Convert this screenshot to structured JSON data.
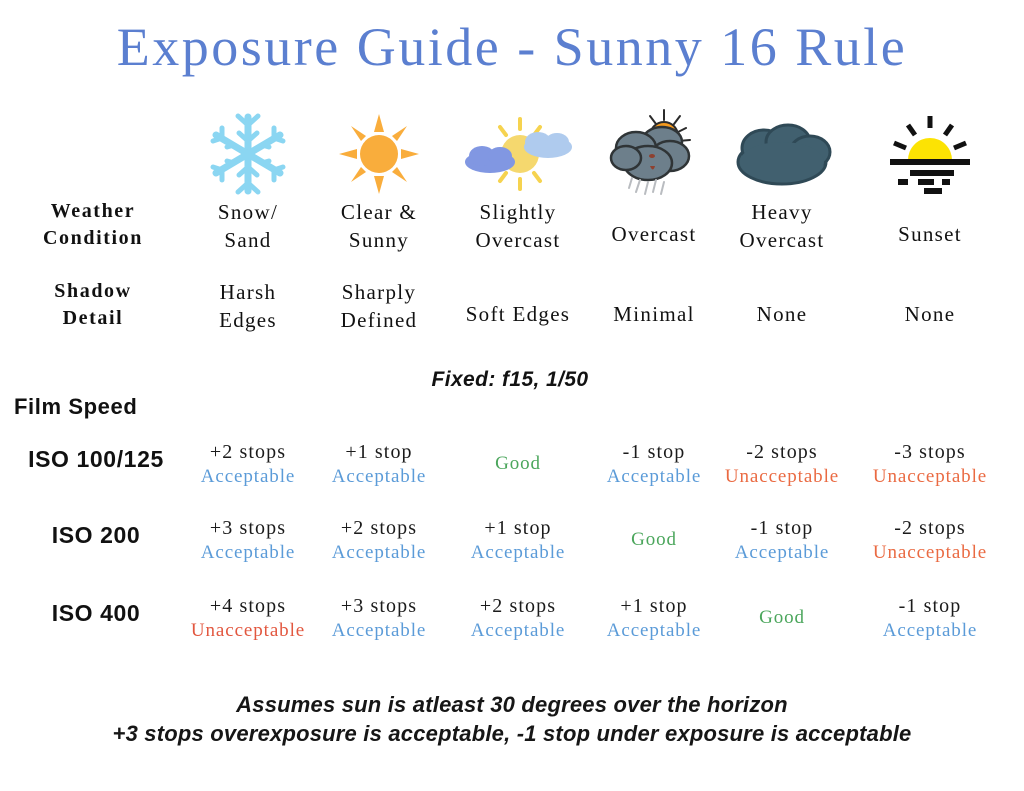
{
  "title": "Exposure Guide - Sunny 16 Rule",
  "colors": {
    "title": "#5b7fd0",
    "acceptable": "#5b9bd8",
    "unacceptable": "#ea6a42",
    "good": "#4ba65c",
    "snow": "#7fd3f0",
    "sun": "#f9a93a",
    "sunset": "#fce303",
    "cloud_dark": "#3f5b6c",
    "cloud_gray": "#6b7c88"
  },
  "row_labels": {
    "weather": "Weather\nCondition",
    "weather_line1": "Weather",
    "weather_line2": "Condition",
    "shadow_line1": "Shadow",
    "shadow_line2": "Detail",
    "film_speed": "Film Speed"
  },
  "fixed_note": "Fixed: f15, 1/50",
  "columns": [
    {
      "icon": "snowflake-icon",
      "weather_line1": "Snow/",
      "weather_line2": "Sand",
      "shadow_line1": "Harsh",
      "shadow_line2": "Edges"
    },
    {
      "icon": "sun-icon",
      "weather_line1": "Clear &",
      "weather_line2": "Sunny",
      "shadow_line1": "Sharply",
      "shadow_line2": "Defined"
    },
    {
      "icon": "partly-cloudy-icon",
      "weather_line1": "Slightly",
      "weather_line2": "Overcast",
      "shadow_line1": "Soft Edges",
      "shadow_line2": ""
    },
    {
      "icon": "rain-cloud-icon",
      "weather_line1": "Overcast",
      "weather_line2": "",
      "shadow_line1": "Minimal",
      "shadow_line2": ""
    },
    {
      "icon": "heavy-cloud-icon",
      "weather_line1": "Heavy",
      "weather_line2": "Overcast",
      "shadow_line1": "None",
      "shadow_line2": ""
    },
    {
      "icon": "sunset-icon",
      "weather_line1": "Sunset",
      "weather_line2": "",
      "shadow_line1": "None",
      "shadow_line2": ""
    }
  ],
  "iso_rows": [
    {
      "label": "ISO 100/125",
      "cells": [
        {
          "stops": "+2 stops",
          "verdict": "Acceptable",
          "status": "acceptable"
        },
        {
          "stops": "+1 stop",
          "verdict": "Acceptable",
          "status": "acceptable"
        },
        {
          "stops": "",
          "verdict": "Good",
          "status": "good"
        },
        {
          "stops": "-1 stop",
          "verdict": "Acceptable",
          "status": "acceptable"
        },
        {
          "stops": "-2 stops",
          "verdict": "Unacceptable",
          "status": "unacceptable"
        },
        {
          "stops": "-3 stops",
          "verdict": "Unacceptable",
          "status": "unacceptable"
        }
      ]
    },
    {
      "label": "ISO 200",
      "cells": [
        {
          "stops": "+3 stops",
          "verdict": "Acceptable",
          "status": "acceptable"
        },
        {
          "stops": "+2 stops",
          "verdict": "Acceptable",
          "status": "acceptable"
        },
        {
          "stops": "+1 stop",
          "verdict": "Acceptable",
          "status": "acceptable"
        },
        {
          "stops": "",
          "verdict": "Good",
          "status": "good"
        },
        {
          "stops": "-1 stop",
          "verdict": "Acceptable",
          "status": "acceptable"
        },
        {
          "stops": "-2 stops",
          "verdict": "Unacceptable",
          "status": "unacceptable"
        }
      ]
    },
    {
      "label": "ISO 400",
      "cells": [
        {
          "stops": "+4 stops",
          "verdict": "Unacceptable",
          "status": "unacceptable-red"
        },
        {
          "stops": "+3 stops",
          "verdict": "Acceptable",
          "status": "acceptable"
        },
        {
          "stops": "+2 stops",
          "verdict": "Acceptable",
          "status": "acceptable"
        },
        {
          "stops": "+1 stop",
          "verdict": "Acceptable",
          "status": "acceptable"
        },
        {
          "stops": "",
          "verdict": "Good",
          "status": "good"
        },
        {
          "stops": "-1 stop",
          "verdict": "Acceptable",
          "status": "acceptable"
        }
      ]
    }
  ],
  "footnotes": [
    "Assumes sun is atleast 30 degrees over the horizon",
    "+3 stops overexposure is acceptable, -1 stop under exposure is acceptable"
  ]
}
